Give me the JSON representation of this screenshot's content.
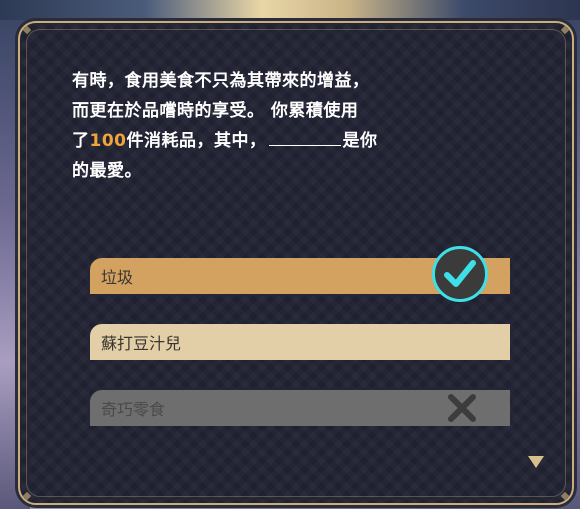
{
  "question": {
    "line1": "有時，食用美食不只為其帶來的增益，",
    "line2": "而更在於品嚐時的享受。 你累積使用",
    "line3_prefix": "了",
    "count": "100",
    "line3_suffix": "件消耗品，其中，",
    "line3_end": "是你",
    "line4": "的最愛。"
  },
  "options": [
    {
      "label": "垃圾",
      "state": "correct"
    },
    {
      "label": "蘇打豆汁兒",
      "state": "neutral"
    },
    {
      "label": "奇巧零食",
      "state": "wrong"
    }
  ],
  "icons": {
    "correct": "check-icon",
    "wrong": "cross-icon",
    "next": "triangle-down-icon"
  },
  "colors": {
    "highlight": "#f0a53c",
    "correct_ring": "#3ee0e8",
    "panel_border": "#c8ae78",
    "option_selected": "#d3a160",
    "option_default": "#e3cfa7",
    "option_disabled": "#6e6e6e"
  }
}
